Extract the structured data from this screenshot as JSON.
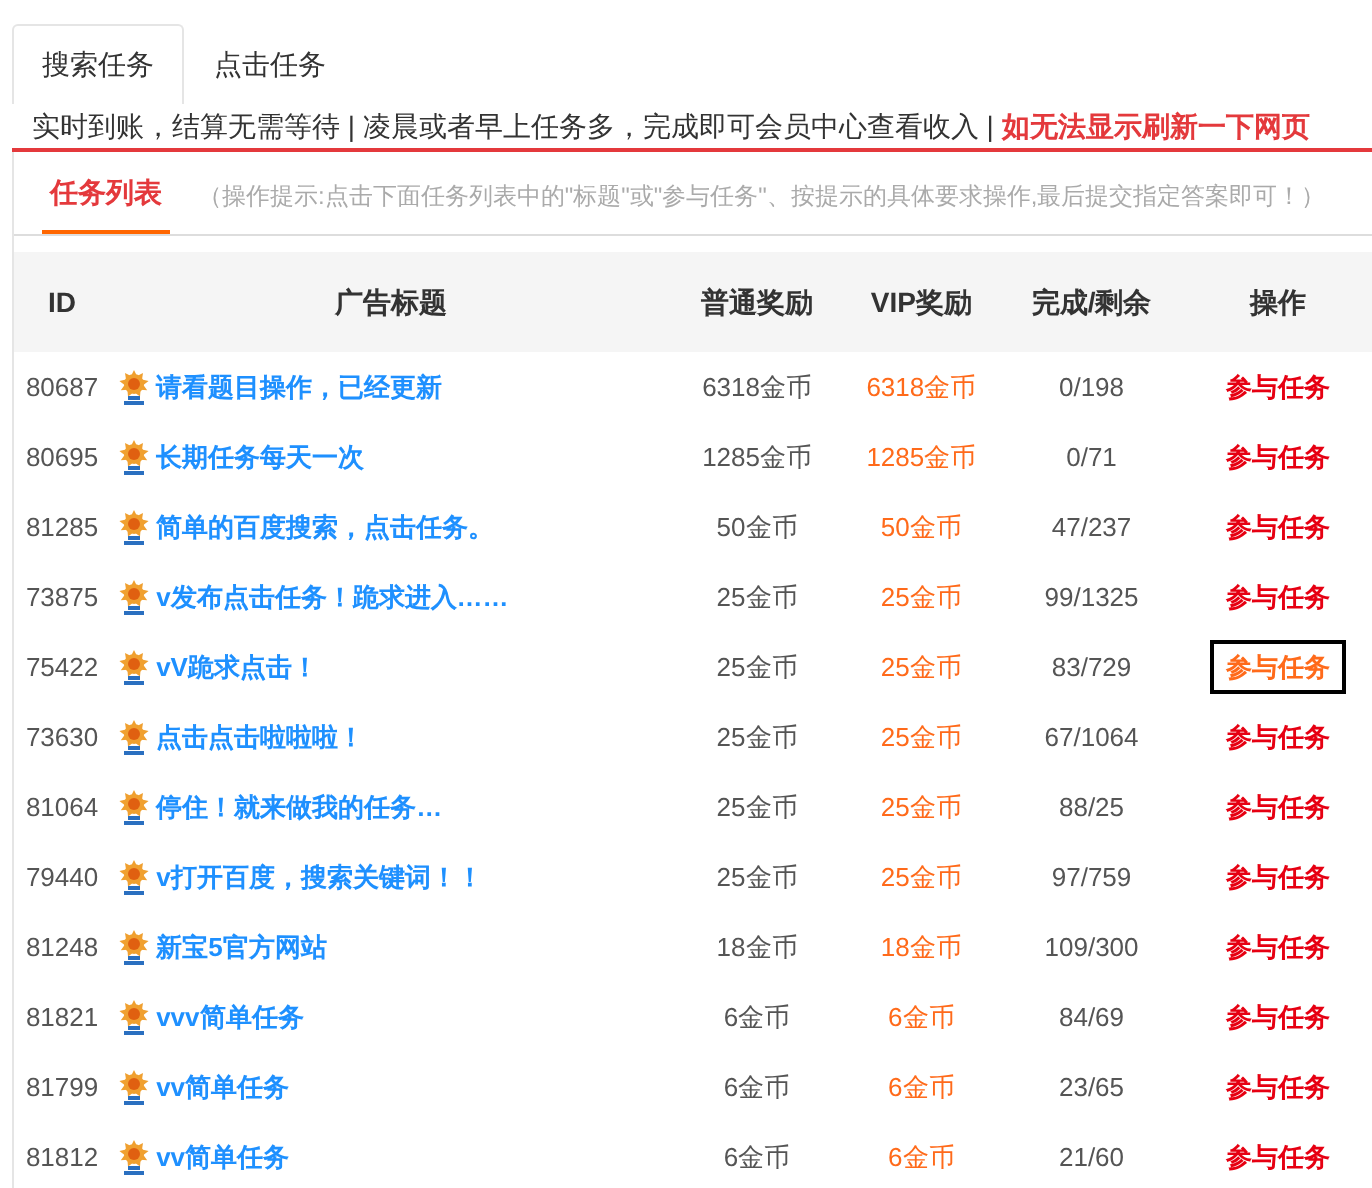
{
  "tabs": [
    {
      "label": "搜索任务",
      "selected": true
    },
    {
      "label": "点击任务",
      "selected": false
    }
  ],
  "notice": {
    "text": "实时到账，结算无需等待 | 凌晨或者早上任务多，完成即可会员中心查看收入 | ",
    "highlight": "如无法显示刷新一下网页"
  },
  "panel": {
    "tab": "任务列表",
    "hint": "（操作提示:点击下面任务列表中的\"标题\"或\"参与任务\"、按提示的具体要求操作,最后提交指定答案即可！）"
  },
  "table": {
    "columns": [
      "ID",
      "广告标题",
      "普通奖励",
      "VIP奖励",
      "完成/剩余",
      "操作"
    ],
    "rows": [
      {
        "id": "80687",
        "title": "请看题目操作，已经更新",
        "reward": "6318金币",
        "vip": "6318金币",
        "progress": "0/198",
        "action": "参与任务",
        "focused": false
      },
      {
        "id": "80695",
        "title": "长期任务每天一次",
        "reward": "1285金币",
        "vip": "1285金币",
        "progress": "0/71",
        "action": "参与任务",
        "focused": false
      },
      {
        "id": "81285",
        "title": "简单的百度搜索，点击任务。",
        "reward": "50金币",
        "vip": "50金币",
        "progress": "47/237",
        "action": "参与任务",
        "focused": false
      },
      {
        "id": "73875",
        "title": "v发布点击任务！跪求进入……",
        "reward": "25金币",
        "vip": "25金币",
        "progress": "99/1325",
        "action": "参与任务",
        "focused": false
      },
      {
        "id": "75422",
        "title": "vV跪求点击！",
        "reward": "25金币",
        "vip": "25金币",
        "progress": "83/729",
        "action": "参与任务",
        "focused": true
      },
      {
        "id": "73630",
        "title": "点击点击啦啦啦！",
        "reward": "25金币",
        "vip": "25金币",
        "progress": "67/1064",
        "action": "参与任务",
        "focused": false
      },
      {
        "id": "81064",
        "title": "停住！就来做我的任务…",
        "reward": "25金币",
        "vip": "25金币",
        "progress": "88/25",
        "action": "参与任务",
        "focused": false
      },
      {
        "id": "79440",
        "title": "v打开百度，搜索关键词！！",
        "reward": "25金币",
        "vip": "25金币",
        "progress": "97/759",
        "action": "参与任务",
        "focused": false
      },
      {
        "id": "81248",
        "title": "新宝5官方网站",
        "reward": "18金币",
        "vip": "18金币",
        "progress": "109/300",
        "action": "参与任务",
        "focused": false
      },
      {
        "id": "81821",
        "title": "vvv简单任务",
        "reward": "6金币",
        "vip": "6金币",
        "progress": "84/69",
        "action": "参与任务",
        "focused": false
      },
      {
        "id": "81799",
        "title": "vv简单任务",
        "reward": "6金币",
        "vip": "6金币",
        "progress": "23/65",
        "action": "参与任务",
        "focused": false
      },
      {
        "id": "81812",
        "title": "vv简单任务",
        "reward": "6金币",
        "vip": "6金币",
        "progress": "21/60",
        "action": "参与任务",
        "focused": false
      }
    ]
  }
}
